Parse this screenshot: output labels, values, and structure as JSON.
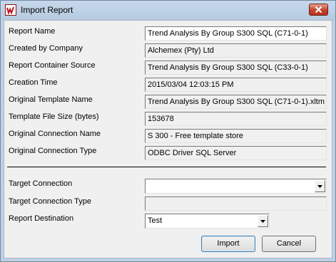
{
  "window": {
    "title": "Import Report"
  },
  "fields": [
    {
      "label": "Report Name",
      "value": "Trend Analysis By Group S300 SQL (C71-0-1)",
      "editable": true
    },
    {
      "label": "Created by Company",
      "value": "Alchemex (Pty) Ltd",
      "editable": false
    },
    {
      "label": "Report Container Source",
      "value": "Trend Analysis By Group S300 SQL (C33-0-1)",
      "editable": false
    },
    {
      "label": "Creation Time",
      "value": "2015/03/04 12:03:15 PM",
      "editable": false
    },
    {
      "label": "Original Template Name",
      "value": "Trend Analysis By Group S300 SQL (C71-0-1).xltm",
      "editable": false
    },
    {
      "label": "Template File Size (bytes)",
      "value": "153678",
      "editable": false
    },
    {
      "label": "Original Connection Name",
      "value": "S 300 - Free template store",
      "editable": false
    },
    {
      "label": "Original Connection Type",
      "value": "ODBC Driver SQL Server",
      "editable": false
    }
  ],
  "target": {
    "connection_label": "Target Connection",
    "connection_value": "",
    "connection_type_label": "Target Connection Type",
    "connection_type_value": "",
    "destination_label": "Report Destination",
    "destination_value": "Test"
  },
  "buttons": {
    "import": "Import",
    "cancel": "Cancel"
  },
  "icons": {
    "app": "report-import-icon",
    "close": "close-icon",
    "dropdown": "chevron-down-icon"
  },
  "colors": {
    "close_button": "#c4422a",
    "title_bar": "#bfd0e3",
    "client": "#f0f0f0"
  }
}
